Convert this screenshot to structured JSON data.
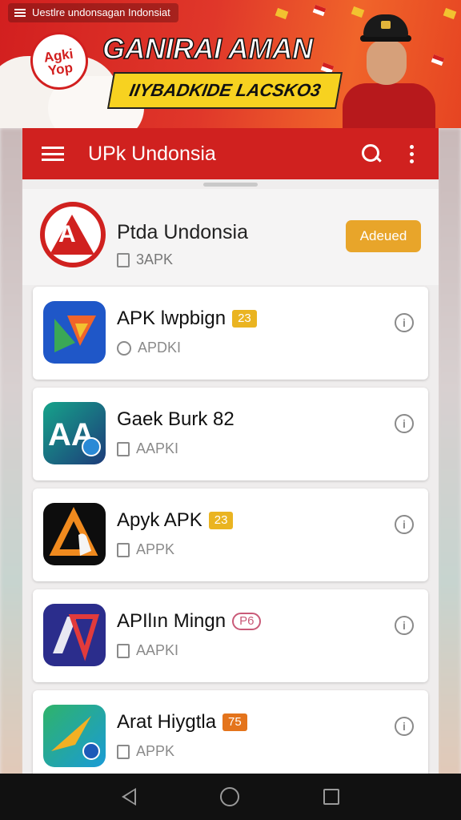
{
  "banner": {
    "notification": "Uestlre undonsagan Indonsiat",
    "logo_text": "Agki Yop",
    "title": "GANIRAI AMAN",
    "subtitle": "IIYBADKIDE LACSKO3"
  },
  "appbar": {
    "title": "UPk Undonsia"
  },
  "featured": {
    "name": "Ptda Undonsia",
    "subtitle": "3APK",
    "button_label": "Adeued"
  },
  "apps": [
    {
      "name": "APK lwpbign",
      "badge": "23",
      "subtitle": "APDKI"
    },
    {
      "name": "Gaek Burk 82",
      "badge": "",
      "subtitle": "AAPKI"
    },
    {
      "name": "Apyk APK",
      "badge": "23",
      "subtitle": "APPK"
    },
    {
      "name": "APIlın Mingn",
      "badge": "P6",
      "subtitle": "AAPKI"
    },
    {
      "name": "Arat Hiygtla",
      "badge": "75",
      "subtitle": "APPK"
    }
  ],
  "info_glyph": "i",
  "colors": {
    "primary_red": "#d0211f",
    "accent_orange": "#e8a52a",
    "badge_yellow": "#eab421"
  }
}
